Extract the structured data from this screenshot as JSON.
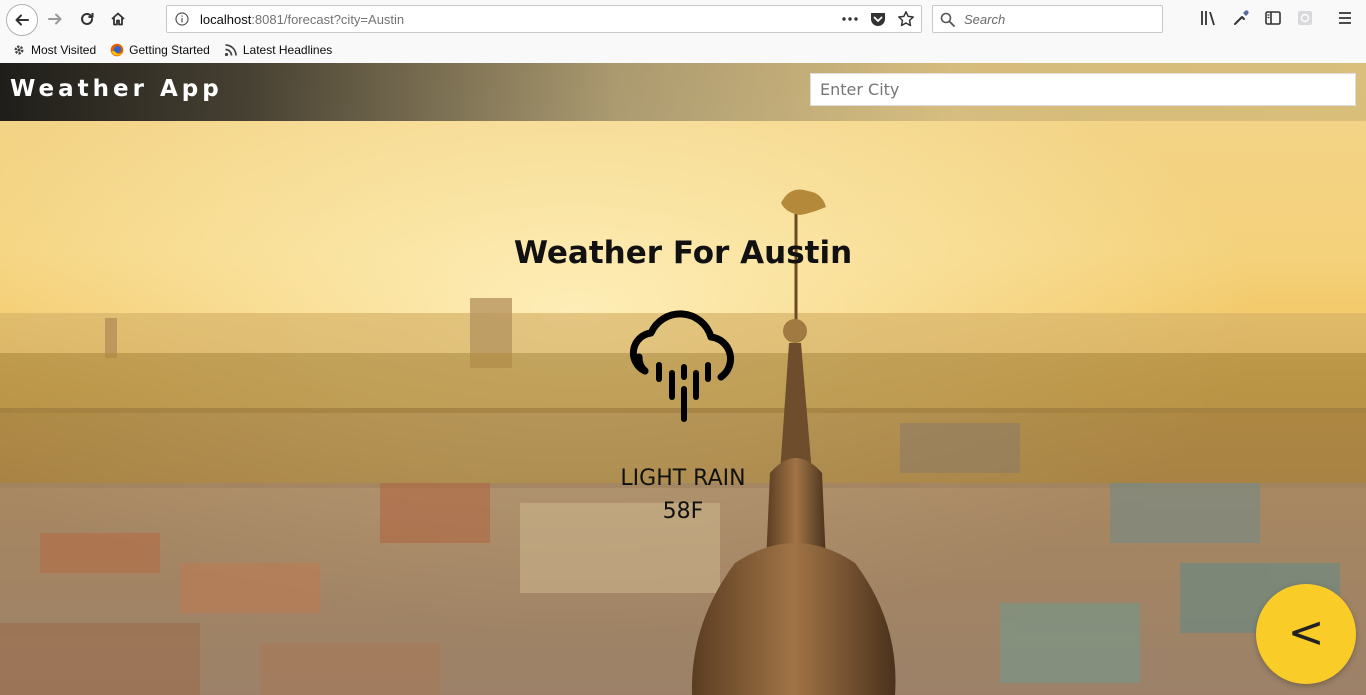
{
  "browser": {
    "url_host": "localhost",
    "url_rest": ":8081/forecast?city=Austin",
    "search_placeholder": "Search",
    "bookmarks": [
      {
        "label": "Most Visited",
        "icon": "gear-icon"
      },
      {
        "label": "Getting Started",
        "icon": "firefox-icon"
      },
      {
        "label": "Latest Headlines",
        "icon": "rss-icon"
      }
    ]
  },
  "app": {
    "title": "Weather App",
    "city_input_placeholder": "Enter City"
  },
  "forecast": {
    "heading": "Weather For Austin",
    "condition": "LIGHT RAIN",
    "temperature": "58F",
    "icon": "cloud-rain-icon"
  },
  "fab": {
    "label": "<",
    "color": "#f9cc27"
  }
}
